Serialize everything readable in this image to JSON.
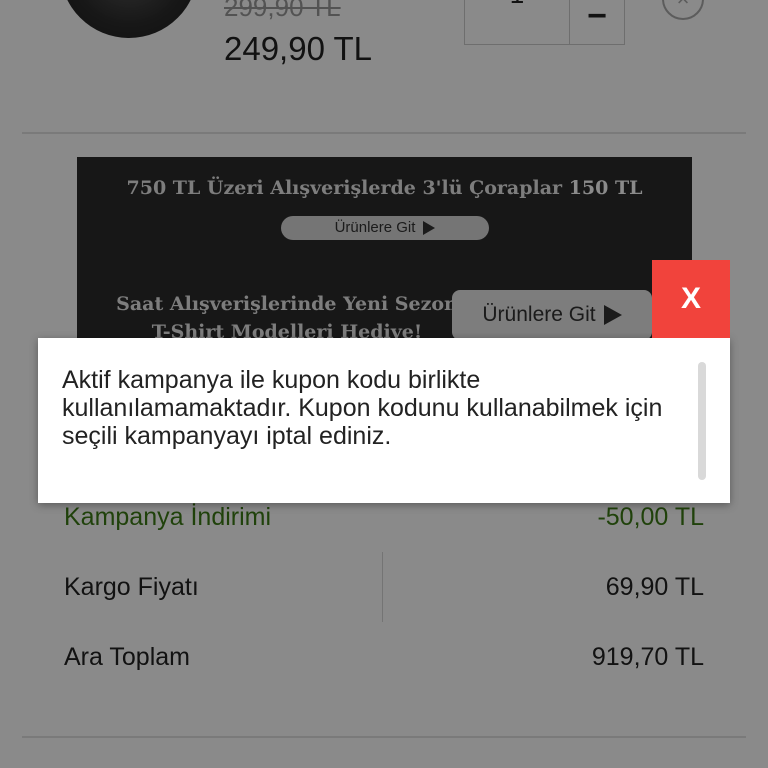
{
  "product": {
    "old_price": "299,90 TL",
    "new_price": "249,90 TL",
    "quantity": "1",
    "minus_label": "−",
    "remove_label": "×"
  },
  "banner": {
    "line1_prefix": "750 TL Üzeri Alışverişlerde 3'lü Çoraplar ",
    "line1_bold": "150 TL",
    "button1": "Ürünlere Git",
    "line2a": "Saat Alışverişlerinde Yeni Sezon",
    "line2b": "T-Shirt Modelleri Hediye!",
    "button2": "Ürünlere Git"
  },
  "summary": {
    "rows": [
      {
        "label": "Kampanya İndirimi",
        "value": "-50,00 TL"
      },
      {
        "label": "Kargo Fiyatı",
        "value": "69,90 TL"
      },
      {
        "label": "Ara Toplam",
        "value": "919,70 TL"
      }
    ]
  },
  "modal": {
    "message": "Aktif kampanya ile kupon kodu birlikte kullanılamamaktadır. Kupon kodunu kullanabilmek için seçili kampanyayı iptal ediniz.",
    "close_label": "X"
  },
  "colors": {
    "close_button": "#f1433c",
    "discount_text": "#3b7a16",
    "banner_bg": "#2b2b2b"
  }
}
